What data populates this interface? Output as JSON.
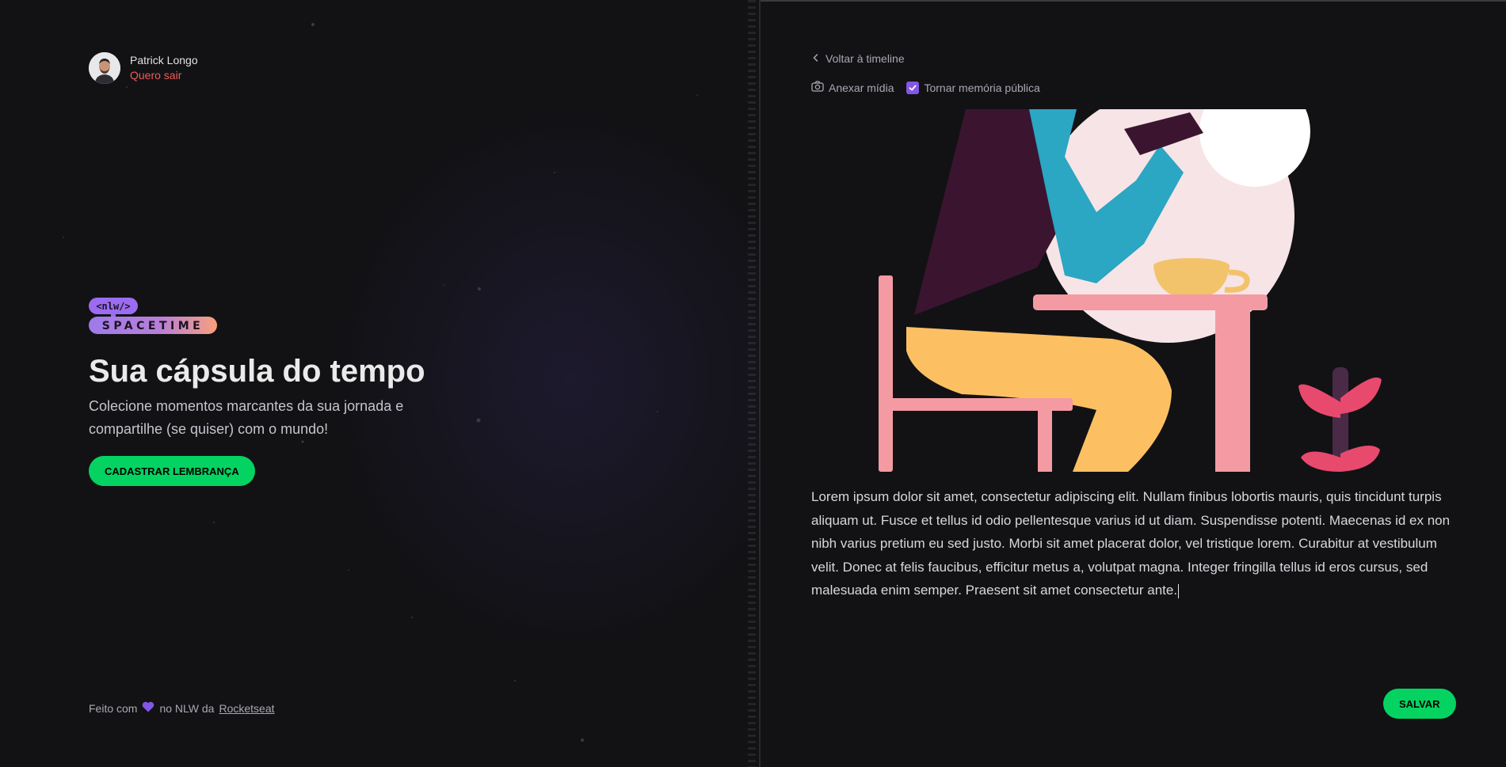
{
  "profile": {
    "name": "Patrick Longo",
    "logout_label": "Quero sair"
  },
  "logo": {
    "tag": "<nlw/>",
    "wordmark": "SPACETIME"
  },
  "hero": {
    "title": "Sua cápsula do tempo",
    "subtitle": "Colecione momentos marcantes da sua jornada e compartilhe (se quiser) com o mundo!",
    "cta_label": "CADASTRAR LEMBRANÇA"
  },
  "footer": {
    "prefix": "Feito com",
    "middle": "no NLW da",
    "link": "Rocketseat"
  },
  "form": {
    "back_label": "Voltar à timeline",
    "attach_label": "Anexar mídia",
    "public_label": "Tornar memória pública",
    "public_checked": true,
    "content": "Lorem ipsum dolor sit amet, consectetur adipiscing elit. Nullam finibus lobortis mauris, quis tincidunt turpis aliquam ut. Fusce et tellus id odio pellentesque varius id ut diam. Suspendisse potenti. Maecenas id ex non nibh varius pretium eu sed justo. Morbi sit amet placerat dolor, vel tristique lorem. Curabitur at vestibulum velit. Donec at felis faucibus, efficitur metus a, volutpat magna. Integer fringilla tellus id eros cursus, sed malesuada enim semper. Praesent sit amet consectetur ante.",
    "save_label": "SALVAR"
  },
  "colors": {
    "accent_green": "#04d361",
    "accent_purple": "#8257e5",
    "logout_red": "#ef5b55"
  }
}
